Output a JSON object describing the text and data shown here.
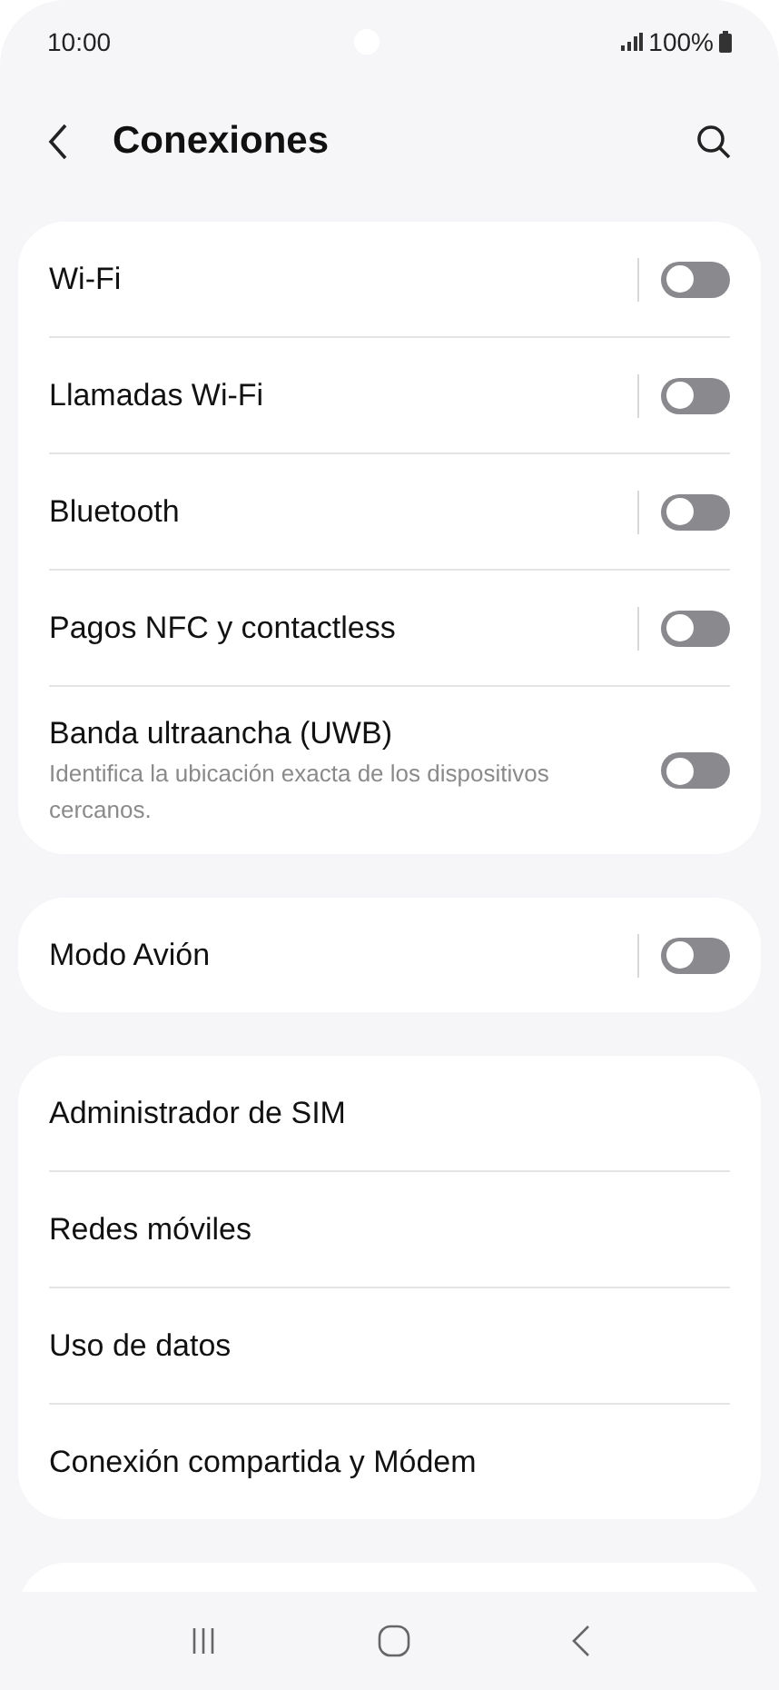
{
  "status_bar": {
    "time": "10:00",
    "battery": "100%"
  },
  "header": {
    "title": "Conexiones"
  },
  "groups": [
    {
      "items": [
        {
          "kind": "toggle",
          "label": "Wi-Fi",
          "on": false,
          "separator": true
        },
        {
          "kind": "toggle",
          "label": "Llamadas Wi-Fi",
          "on": false,
          "separator": true
        },
        {
          "kind": "toggle",
          "label": "Bluetooth",
          "on": false,
          "separator": true
        },
        {
          "kind": "toggle",
          "label": "Pagos NFC y contactless",
          "on": false,
          "separator": true
        },
        {
          "kind": "toggle",
          "label": "Banda ultraancha (UWB)",
          "description": "Identifica la ubicación exacta de los dispositivos cercanos.",
          "on": false,
          "separator": false
        }
      ]
    },
    {
      "items": [
        {
          "kind": "toggle",
          "label": "Modo Avión",
          "on": false,
          "separator": true
        }
      ]
    },
    {
      "items": [
        {
          "kind": "link",
          "label": "Administrador de SIM"
        },
        {
          "kind": "link",
          "label": "Redes móviles"
        },
        {
          "kind": "link",
          "label": "Uso de datos"
        },
        {
          "kind": "link",
          "label": "Conexión compartida y Módem"
        }
      ]
    }
  ]
}
